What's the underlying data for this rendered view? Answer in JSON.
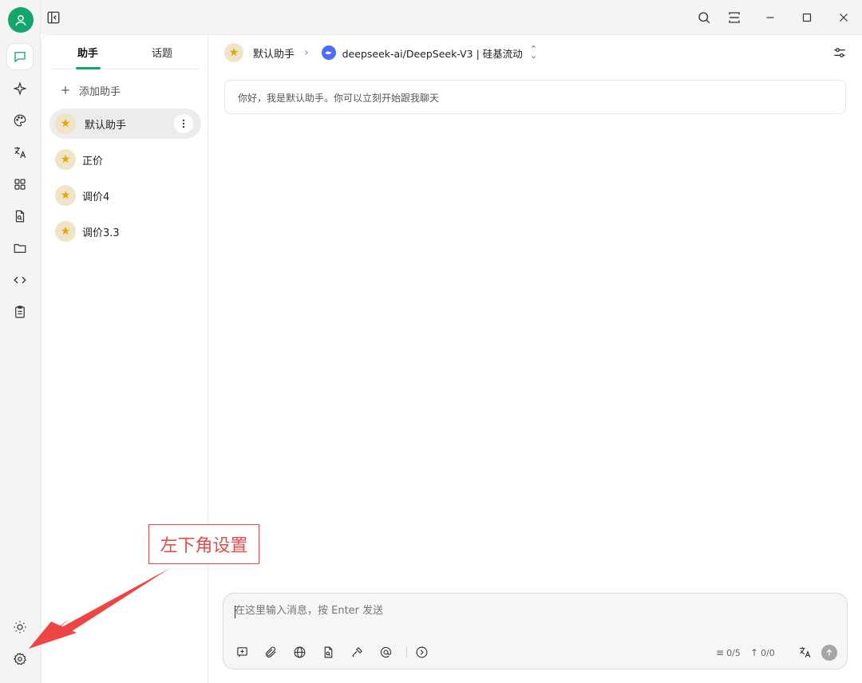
{
  "titlebar": {
    "icons": [
      "sidebar-toggle-icon",
      "search-icon",
      "scan-icon",
      "minimize-icon",
      "maximize-icon",
      "close-icon"
    ]
  },
  "rail": {
    "items": [
      "chat-icon",
      "sparkle-icon",
      "palette-icon",
      "translate-icon",
      "apps-icon",
      "file-search-icon",
      "folder-icon",
      "code-icon",
      "clipboard-icon"
    ],
    "bottom": [
      "sun-icon",
      "gear-icon"
    ]
  },
  "panel": {
    "tabs": [
      {
        "label": "助手"
      },
      {
        "label": "话题"
      }
    ],
    "add_label": "添加助手",
    "assistants": [
      {
        "emoji": "⭐",
        "name": "默认助手"
      },
      {
        "emoji": "⭐",
        "name": "正价"
      },
      {
        "emoji": "⭐",
        "name": "调价4"
      },
      {
        "emoji": "⭐",
        "name": "调价3.3"
      }
    ]
  },
  "main": {
    "assistant_name": "默认助手",
    "model": "deepseek-ai/DeepSeek-V3 | 硅基流动",
    "welcome": "你好，我是默认助手。你可以立刻开始跟我聊天"
  },
  "input": {
    "placeholder": "在这里输入消息，按 Enter 发送",
    "context_count": "0/5",
    "token_count": "0/0"
  },
  "annotation": {
    "text": "左下角设置",
    "color": "#e84a4a"
  },
  "colors": {
    "accent": "#12a66a",
    "model_logo": "#4d6bfe"
  }
}
